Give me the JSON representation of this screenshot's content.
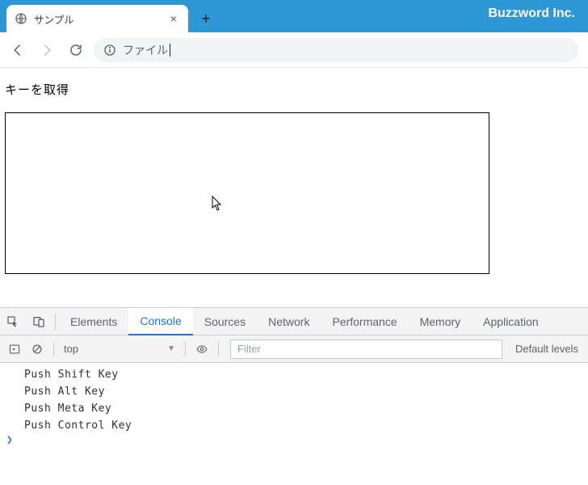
{
  "browser": {
    "brand": "Buzzword Inc.",
    "tab_title": "サンプル",
    "new_tab_glyph": "+",
    "close_glyph": "×"
  },
  "address_bar": {
    "prefix": "ファイル",
    "url_display": ""
  },
  "page": {
    "heading": "キーを取得"
  },
  "devtools": {
    "tabs": {
      "elements": "Elements",
      "console": "Console",
      "sources": "Sources",
      "network": "Network",
      "performance": "Performance",
      "memory": "Memory",
      "application": "Application"
    },
    "active_tab": "console",
    "toolbar": {
      "context": "top",
      "filter_placeholder": "Filter",
      "levels": "Default levels"
    },
    "logs": [
      "Push Shift Key",
      "Push Alt Key",
      "Push Meta Key",
      "Push Control Key"
    ],
    "prompt": "❯"
  }
}
